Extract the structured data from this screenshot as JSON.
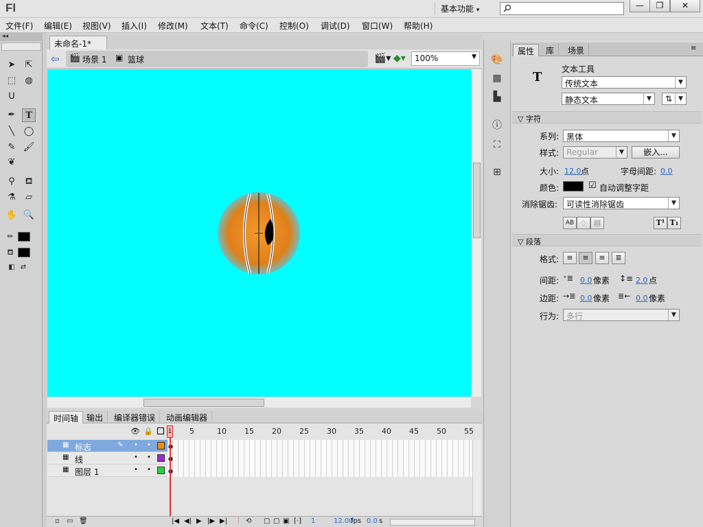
{
  "app": {
    "logo": "Fl",
    "workspace": "基本功能",
    "search_placeholder": ""
  },
  "window_buttons": {
    "minimize": "—",
    "restore": "❐",
    "close": "✕"
  },
  "menu": [
    "文件(F)",
    "编辑(E)",
    "视图(V)",
    "插入(I)",
    "修改(M)",
    "文本(T)",
    "命令(C)",
    "控制(O)",
    "调试(D)",
    "窗口(W)",
    "帮助(H)"
  ],
  "document": {
    "tab_title": "未命名-1*",
    "tab_close": "×",
    "breadcrumb_scene": "场景 1",
    "breadcrumb_symbol": "篮球",
    "zoom": "100%",
    "stage_color": "#00ffff",
    "ball_color": "#e9861f"
  },
  "timeline": {
    "tabs": [
      "时间轴",
      "输出",
      "编译器错误",
      "动画编辑器"
    ],
    "frame_numbers": [
      "5",
      "10",
      "15",
      "20",
      "25",
      "30",
      "35",
      "40",
      "45",
      "50",
      "55"
    ],
    "current_frame_label": "1",
    "layers": [
      {
        "name": "标志",
        "color": "#f08a1a",
        "selected": true
      },
      {
        "name": "线",
        "color": "#9a2bd0",
        "selected": false
      },
      {
        "name": "图层 1",
        "color": "#29d23a",
        "selected": false
      }
    ],
    "status": {
      "frame": "1",
      "fps": "12.00",
      "fps_unit": "fps",
      "time": "0.0",
      "time_unit": "s"
    }
  },
  "properties": {
    "tabs": [
      "属性",
      "库",
      "场景"
    ],
    "tool_glyph": "T",
    "tool_name": "文本工具",
    "text_engine": "传统文本",
    "text_type": "静态文本",
    "char_section": "字符",
    "family_label": "系列:",
    "family_value": "黑体",
    "style_label": "样式:",
    "style_value": "Regular",
    "embed_button": "嵌入...",
    "size_label": "大小:",
    "size_value": "12.0",
    "size_unit": "点",
    "letter_spacing_label": "字母间距:",
    "letter_spacing_value": "0.0",
    "color_label": "颜色:",
    "color_value": "#000000",
    "auto_kern_label": "自动调整字距",
    "auto_kern_checked": "☑",
    "antialias_label": "消除锯齿:",
    "antialias_value": "可读性消除锯齿",
    "para_section": "段落",
    "format_label": "格式:",
    "spacing_label": "间距:",
    "spacing_indent": "0.0",
    "spacing_indent_unit": "像素",
    "line_spacing": "2.0",
    "line_spacing_unit": "点",
    "margin_label": "边距:",
    "margin_left": "0.0",
    "margin_left_unit": "像素",
    "margin_right": "0.0",
    "margin_right_unit": "像素",
    "behavior_label": "行为:",
    "behavior_value": "多行"
  }
}
